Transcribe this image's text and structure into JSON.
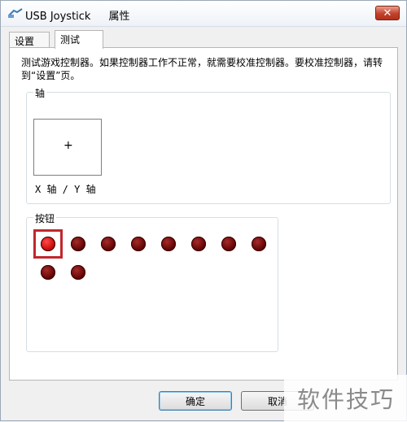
{
  "window": {
    "app_name": "USB Joystick",
    "title_suffix": "属性",
    "close_glyph": "✕"
  },
  "tabs": [
    {
      "label": "设置",
      "active": false
    },
    {
      "label": "测试",
      "active": true
    }
  ],
  "test_tab": {
    "description": "测试游戏控制器。如果控制器工作不正常，就需要校准控制器。要校准控制器，请转到“设置”页。",
    "axis_group": {
      "label": "轴",
      "crosshair_glyph": "+",
      "axis_label": "X 轴 / Y 轴"
    },
    "buttons_group": {
      "label": "按钮",
      "button_count": 10,
      "pressed_buttons": [
        1
      ]
    }
  },
  "footer": {
    "ok_label": "确定",
    "cancel_label": "取消"
  },
  "watermark": {
    "text": "软件技巧"
  },
  "colors": {
    "button_idle": "#5a0000",
    "button_pressed": "#e01010",
    "highlight": "#c0282d"
  }
}
